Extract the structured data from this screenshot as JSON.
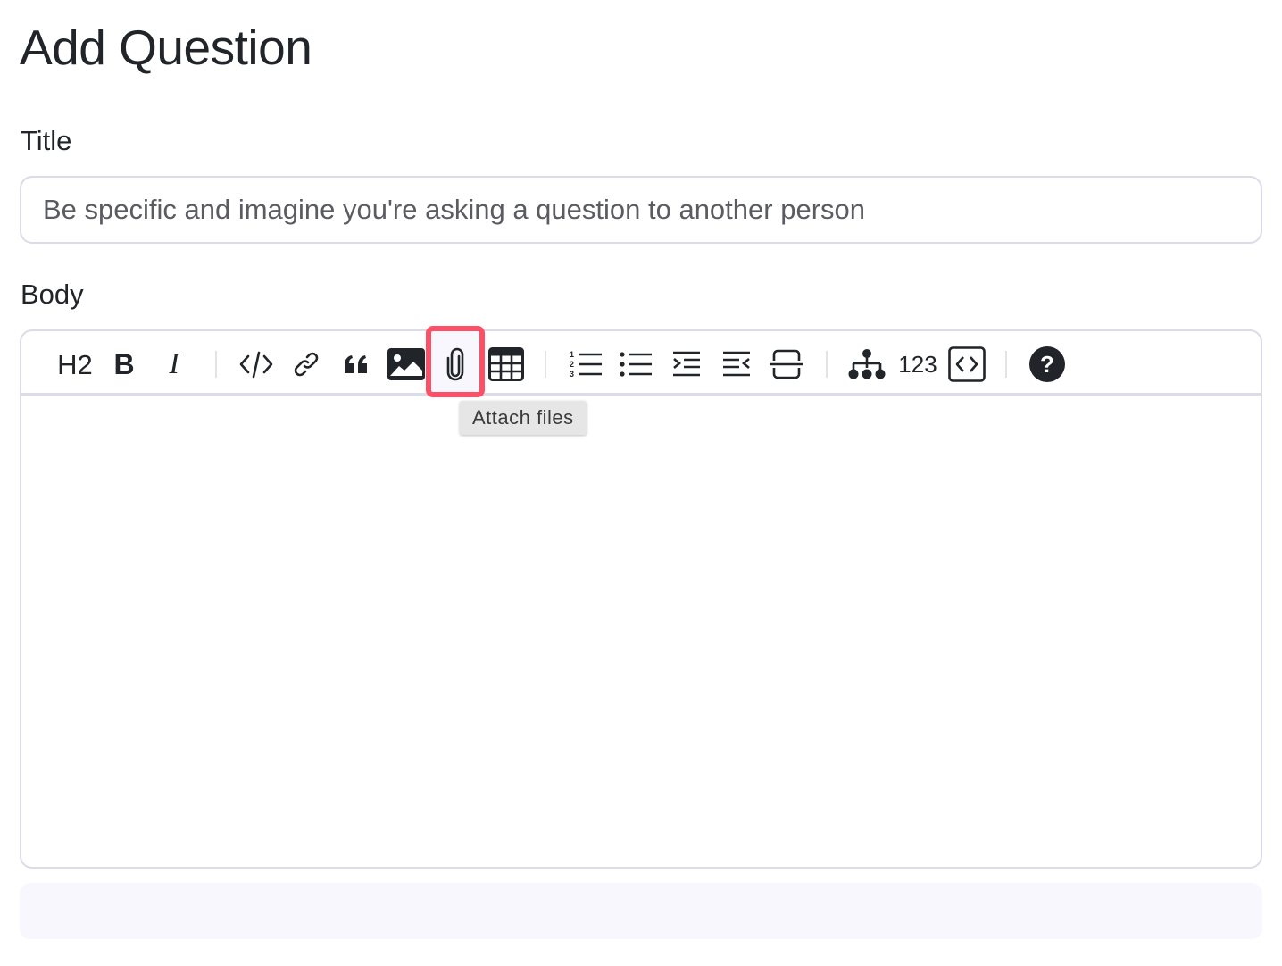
{
  "page": {
    "title": "Add Question"
  },
  "form": {
    "title_label": "Title",
    "title_placeholder": "Be specific and imagine you're asking a question to another person",
    "title_value": "",
    "body_label": "Body",
    "body_value": ""
  },
  "toolbar": {
    "heading_label": "H2",
    "bold_label": "B",
    "italic_label": "I",
    "number_label": "123",
    "buttons": [
      {
        "name": "heading",
        "icon": "heading-icon"
      },
      {
        "name": "bold",
        "icon": "bold-icon"
      },
      {
        "name": "italic",
        "icon": "italic-icon"
      },
      {
        "name": "code",
        "icon": "code-icon"
      },
      {
        "name": "link",
        "icon": "link-icon"
      },
      {
        "name": "blockquote",
        "icon": "quote-icon"
      },
      {
        "name": "image",
        "icon": "image-icon"
      },
      {
        "name": "attach-files",
        "icon": "paperclip-icon"
      },
      {
        "name": "table",
        "icon": "table-icon"
      },
      {
        "name": "ordered-list",
        "icon": "ordered-list-icon"
      },
      {
        "name": "unordered-list",
        "icon": "unordered-list-icon"
      },
      {
        "name": "indent",
        "icon": "indent-icon"
      },
      {
        "name": "outdent",
        "icon": "outdent-icon"
      },
      {
        "name": "horizontal-rule",
        "icon": "horizontal-rule-icon"
      },
      {
        "name": "chart",
        "icon": "hierarchy-icon"
      },
      {
        "name": "formula",
        "icon": "number-icon"
      },
      {
        "name": "html",
        "icon": "code-block-icon"
      },
      {
        "name": "help",
        "icon": "question-circle-icon"
      }
    ],
    "tooltip": "Attach files",
    "highlight_color": "#ff4f67"
  },
  "colors": {
    "text": "#212529",
    "border": "#dcdbe8",
    "placeholder": "#5a5c61",
    "preview_bg": "#f7f7fd"
  }
}
